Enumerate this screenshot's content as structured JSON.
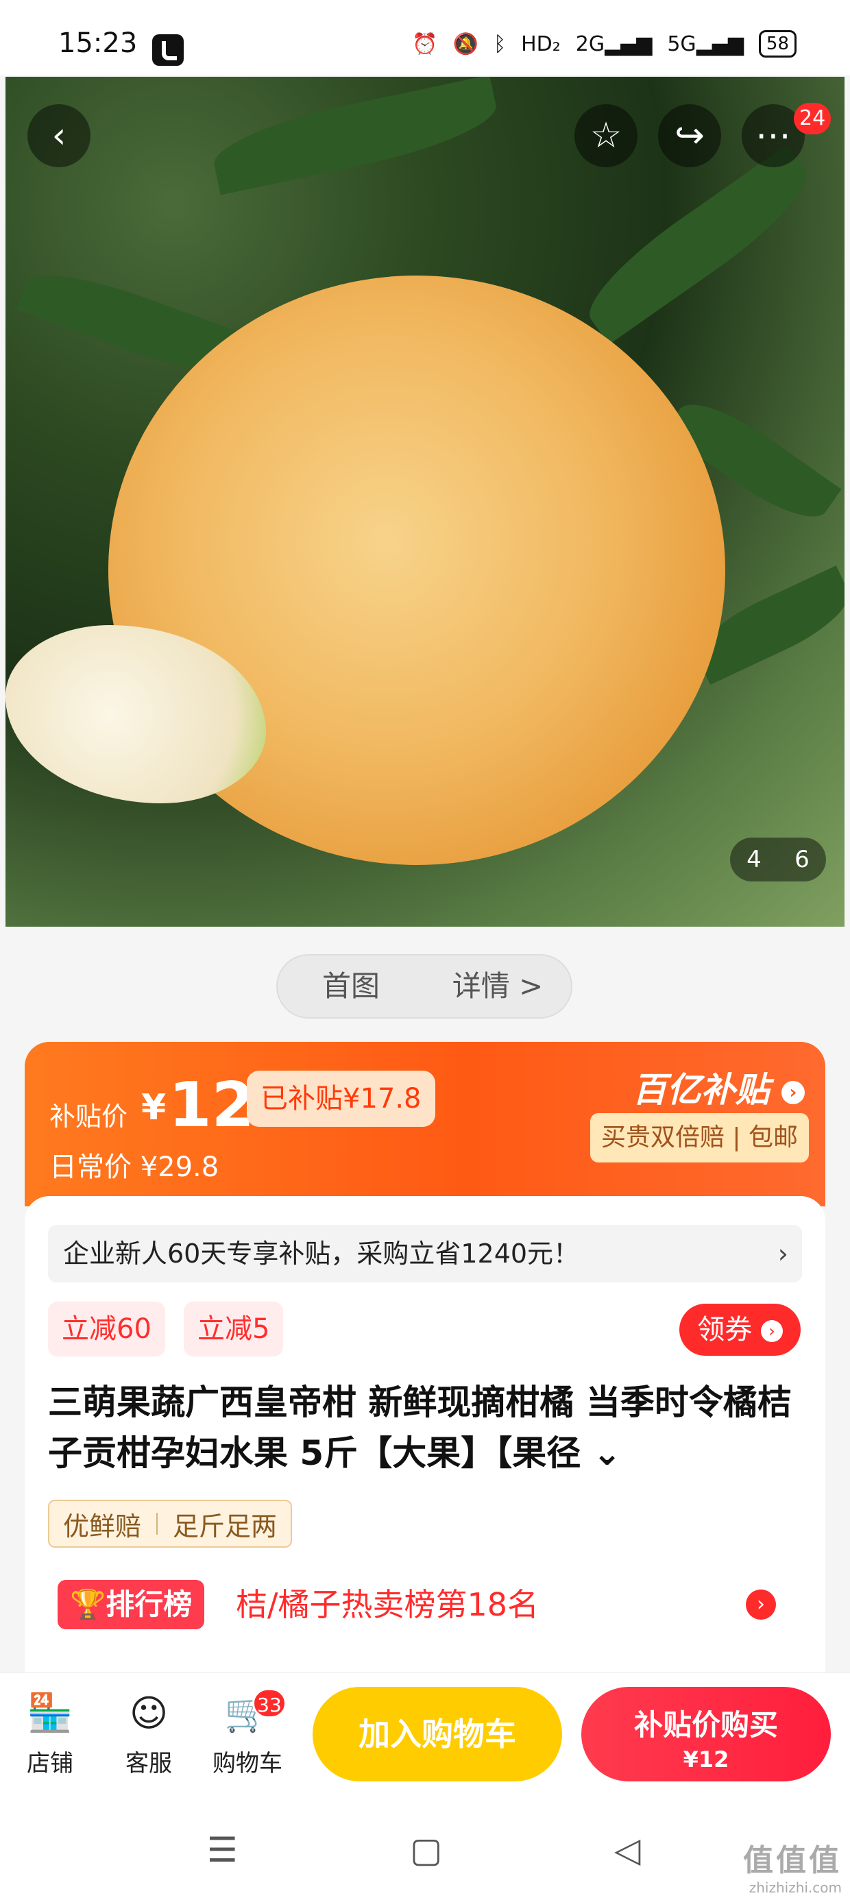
{
  "status_bar": {
    "time": "15:23",
    "network_1": "HD₂",
    "network_2": "2G",
    "network_3": "5G",
    "battery": "58"
  },
  "hero": {
    "more_badge": "24",
    "page_current": "4",
    "page_total": "6"
  },
  "image_switch": {
    "first": "首图",
    "detail": "详情 >"
  },
  "price": {
    "label": "补贴价",
    "currency": "¥",
    "value": "12",
    "subsidy_tag": "已补贴¥17.8",
    "daily_label": "日常价 ¥29.8",
    "brand": "百亿补贴",
    "guarantee": "买贵双倍赔 | 包邮"
  },
  "promo": {
    "text": "企业新人60天专享补贴，采购立省1240元！",
    "chevron": "›"
  },
  "coupons": [
    "立减60",
    "立减5"
  ],
  "get_coupon": "领券",
  "title": "三萌果蔬广西皇帝柑 新鲜现摘柑橘 当季时令橘桔子贡柑孕妇水果 5斤【大果】【果径",
  "features": [
    "优鲜赔",
    "足斤足两"
  ],
  "ranking": {
    "badge": "排行榜",
    "text": "桔/橘子热卖榜第18名"
  },
  "bottom_bar": {
    "shop": "店铺",
    "service": "客服",
    "cart": "购物车",
    "cart_badge": "33",
    "add_to_cart": "加入购物车",
    "buy_label": "补贴价购买",
    "buy_price": "¥12"
  },
  "watermark": {
    "text": "值值值",
    "url": "zhizhizhi.com"
  },
  "colors": {
    "accent_orange": "#ff5a14",
    "accent_red": "#ff2b2b",
    "cart_yellow": "#ffcc00"
  }
}
